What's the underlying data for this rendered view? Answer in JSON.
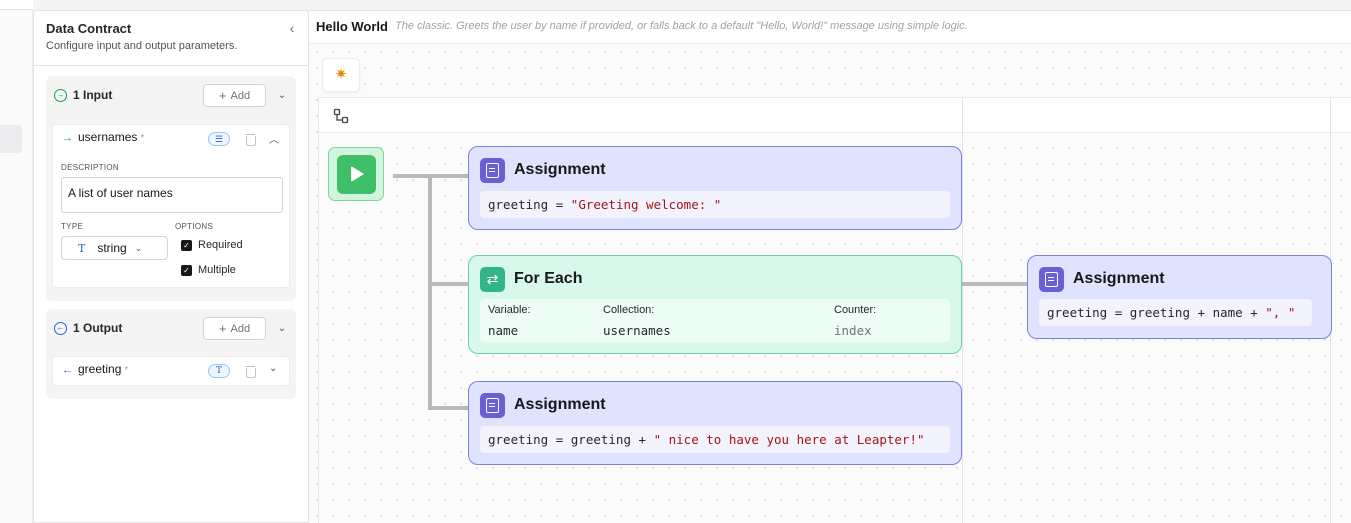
{
  "panel": {
    "title": "Data Contract",
    "subtitle": "Configure input and output parameters.",
    "inputs": {
      "title": "1 Input",
      "add_label": "Add",
      "field": {
        "name": "usernames",
        "required_mark": "*",
        "description_label": "DESCRIPTION",
        "description": "A list of user names",
        "type_label": "TYPE",
        "type_value": "string",
        "options_label": "OPTIONS",
        "options": [
          "Required",
          "Multiple"
        ]
      }
    },
    "outputs": {
      "title": "1 Output",
      "add_label": "Add",
      "field": {
        "name": "greeting",
        "required_mark": "*"
      }
    }
  },
  "canvas": {
    "title": "Hello World",
    "description": "The classic. Greets the user by name if provided, or falls back to a default \"Hello, World!\" message using simple logic.",
    "nodes": {
      "assign1": {
        "title": "Assignment",
        "code_var": "greeting = ",
        "code_str": "\"Greeting welcome: \""
      },
      "foreach": {
        "title": "For Each",
        "variable_label": "Variable:",
        "variable": "name",
        "collection_label": "Collection:",
        "collection": "usernames",
        "counter_label": "Counter:",
        "counter": "index"
      },
      "assign2": {
        "title": "Assignment",
        "code_var": "greeting = greeting + ",
        "code_str": "\" nice to have you here at Leapter!\""
      },
      "assign3": {
        "title": "Assignment",
        "code_var": "greeting = greeting + name + ",
        "code_str": "\", \""
      }
    }
  },
  "colors": {
    "assign_bg": "#e0e3fd",
    "assign_accent": "#6b5fd5",
    "foreach_bg": "#d8f8ec",
    "foreach_accent": "#33b58a",
    "start_accent": "#3fbf6a"
  },
  "icons": [
    "arrow-right-circle-icon",
    "arrow-left-circle-icon",
    "list-icon",
    "trash-icon",
    "type-icon",
    "sparkles-icon",
    "network-icon",
    "play-icon",
    "document-icon",
    "loop-icon",
    "chevron-down-icon",
    "chevron-up-icon",
    "chevron-left-icon"
  ]
}
